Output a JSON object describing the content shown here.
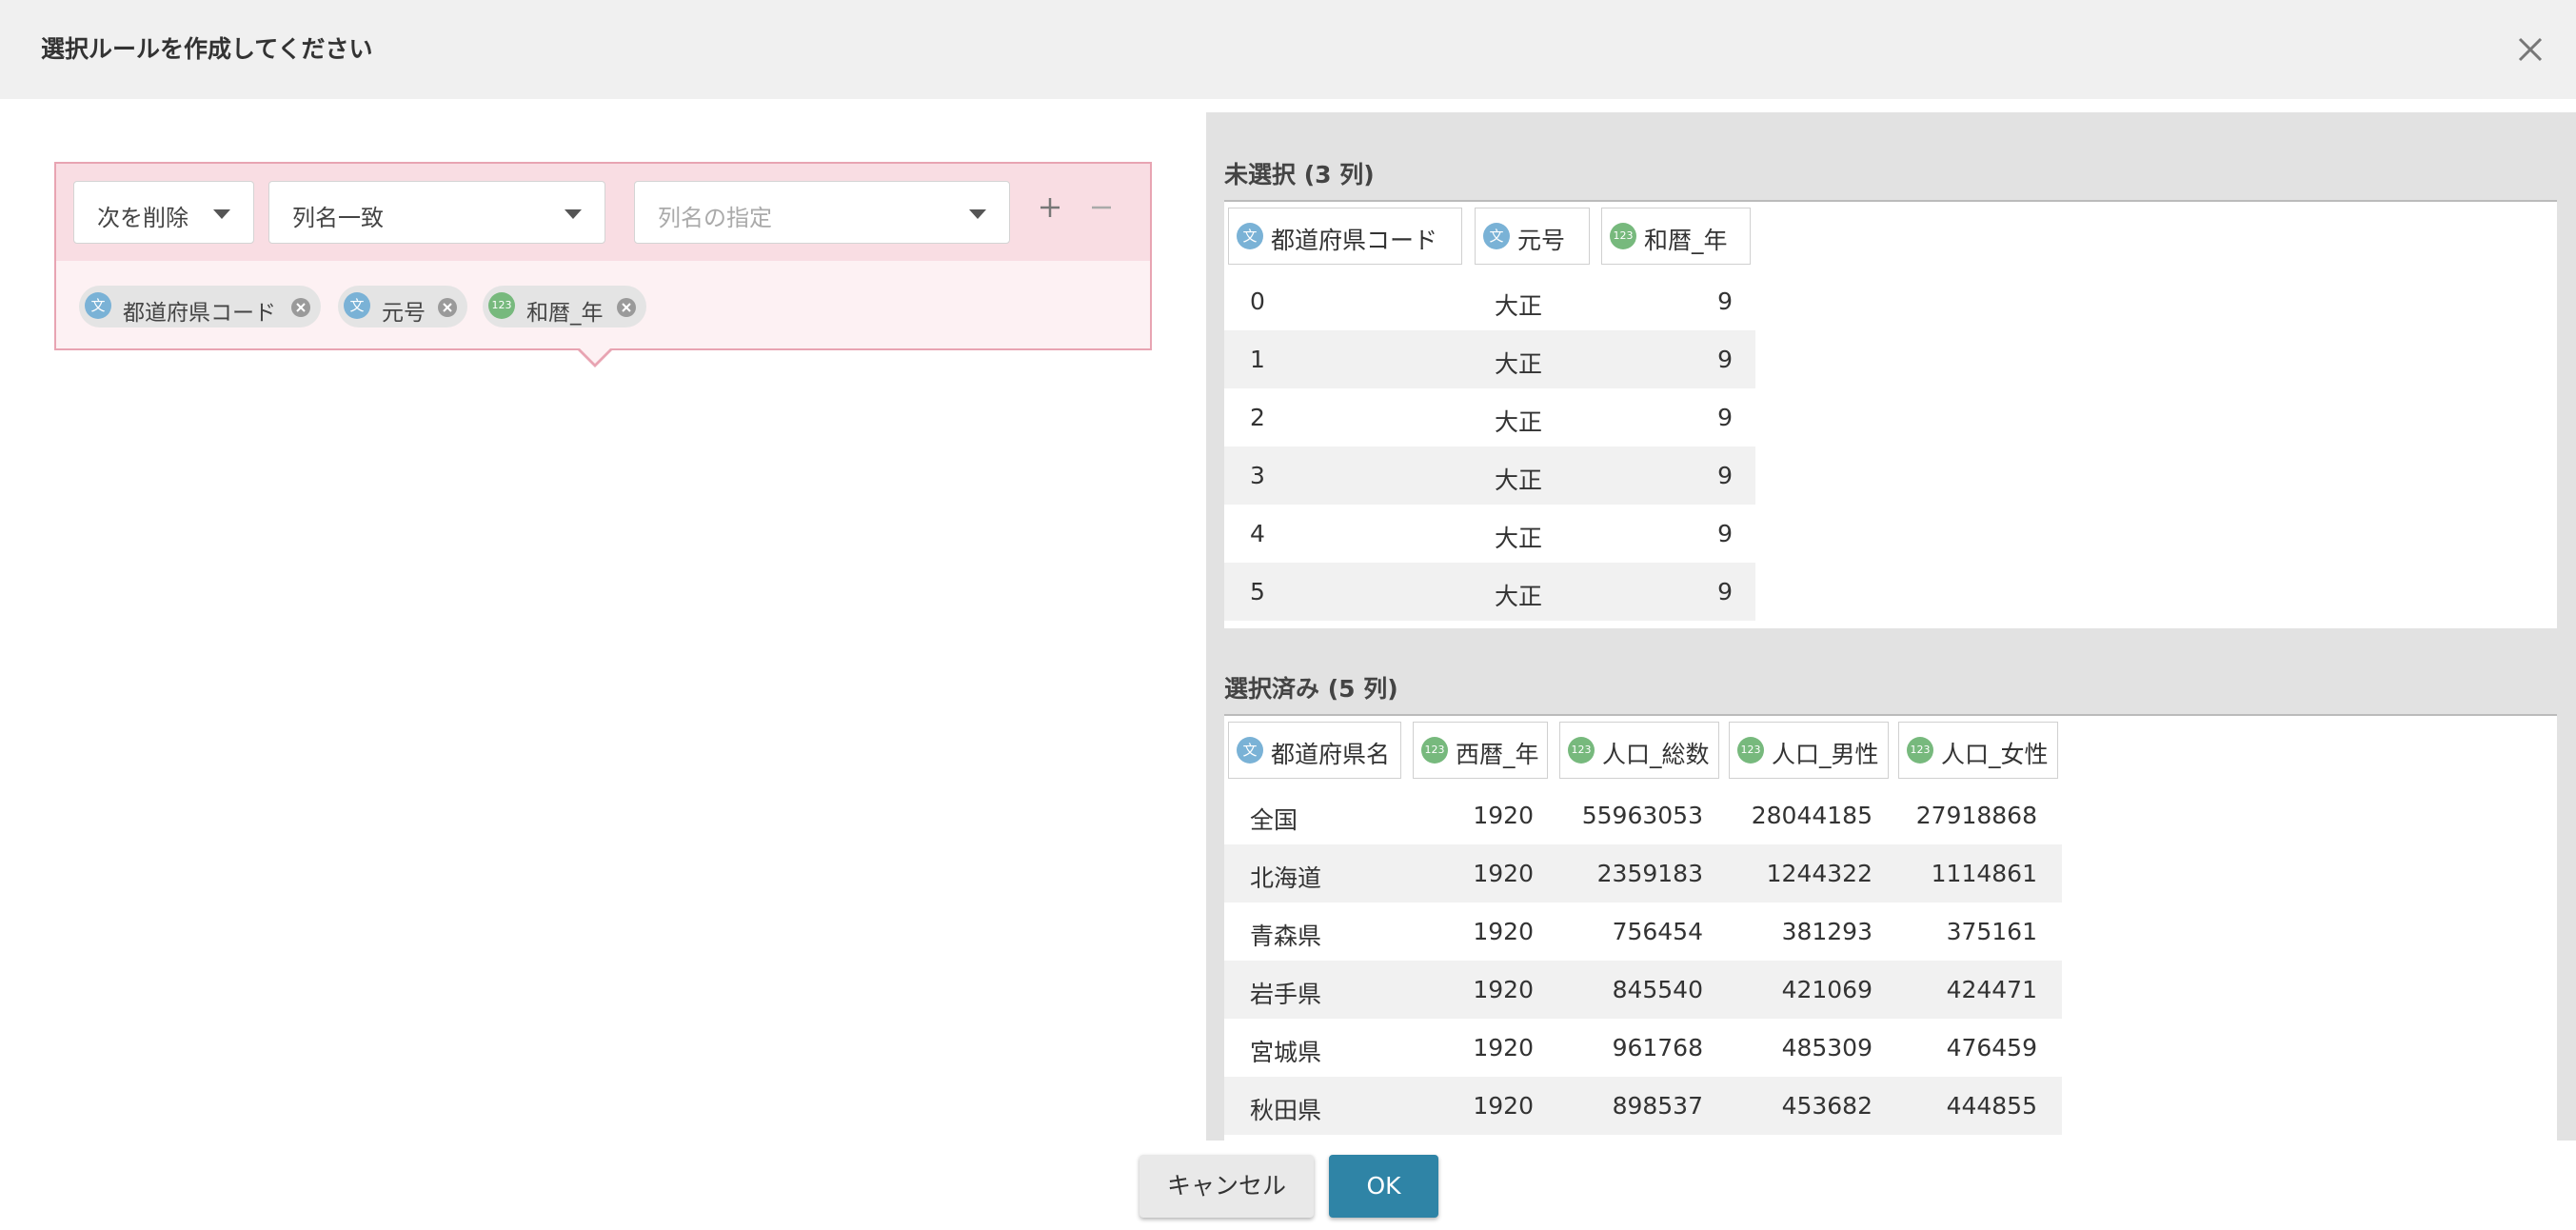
{
  "dialog": {
    "title": "選択ルールを作成してください"
  },
  "rule": {
    "action_select": "次を削除",
    "match_select": "列名一致",
    "column_placeholder": "列名の指定",
    "chips": [
      {
        "type": "文",
        "kind": "str",
        "label": "都道府県コード"
      },
      {
        "type": "123",
        "kind": "str",
        "label": "元号"
      },
      {
        "type": "123",
        "kind": "num",
        "label": "和暦_年"
      }
    ]
  },
  "unselected": {
    "title": "未選択 (3 列)",
    "columns": [
      {
        "type": "文",
        "kind": "str",
        "label": "都道府県コード"
      },
      {
        "type": "文",
        "kind": "str",
        "label": "元号"
      },
      {
        "type": "123",
        "kind": "num",
        "label": "和暦_年"
      }
    ],
    "rows": [
      [
        "0",
        "大正",
        "9"
      ],
      [
        "1",
        "大正",
        "9"
      ],
      [
        "2",
        "大正",
        "9"
      ],
      [
        "3",
        "大正",
        "9"
      ],
      [
        "4",
        "大正",
        "9"
      ],
      [
        "5",
        "大正",
        "9"
      ]
    ]
  },
  "selected": {
    "title": "選択済み (5 列)",
    "columns": [
      {
        "type": "文",
        "kind": "str",
        "label": "都道府県名"
      },
      {
        "type": "123",
        "kind": "num",
        "label": "西暦_年"
      },
      {
        "type": "123",
        "kind": "num",
        "label": "人口_総数"
      },
      {
        "type": "123",
        "kind": "num",
        "label": "人口_男性"
      },
      {
        "type": "123",
        "kind": "num",
        "label": "人口_女性"
      }
    ],
    "rows": [
      [
        "全国",
        "1920",
        "55963053",
        "28044185",
        "27918868"
      ],
      [
        "北海道",
        "1920",
        "2359183",
        "1244322",
        "1114861"
      ],
      [
        "青森県",
        "1920",
        "756454",
        "381293",
        "375161"
      ],
      [
        "岩手県",
        "1920",
        "845540",
        "421069",
        "424471"
      ],
      [
        "宮城県",
        "1920",
        "961768",
        "485309",
        "476459"
      ],
      [
        "秋田県",
        "1920",
        "898537",
        "453682",
        "444855"
      ]
    ]
  },
  "footer": {
    "cancel_label": "キャンセル",
    "ok_label": "OK"
  },
  "colors": {
    "accent": "#2f84a6",
    "rule_border": "#e8a4b2",
    "string_badge": "#7ab2d6",
    "number_badge": "#77b97d"
  }
}
